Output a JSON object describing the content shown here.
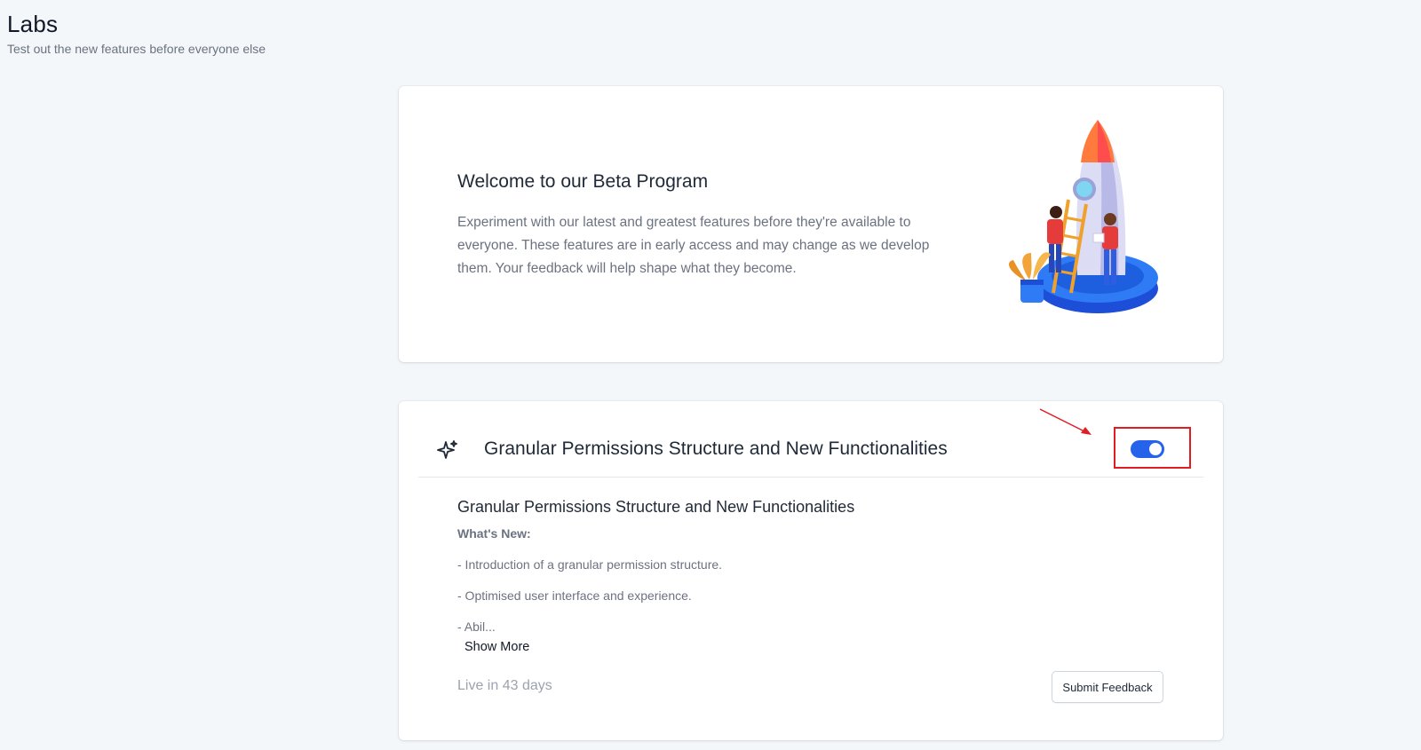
{
  "header": {
    "title": "Labs",
    "subtitle": "Test out the new features before everyone else"
  },
  "welcome": {
    "title": "Welcome to our Beta Program",
    "description": "Experiment with our latest and greatest features before they're available to everyone. These features are in early access and may change as we develop them. Your feedback will help shape what they become.",
    "illustration": "rocket-launch-illustration"
  },
  "feature": {
    "icon": "sparkle-icon",
    "title": "Granular Permissions Structure and New Functionalities",
    "enabled": true,
    "details_title": "Granular Permissions Structure and New Functionalities",
    "whats_new_label": "What's New:",
    "items": [
      "- Introduction of a granular permission structure.",
      "- Optimised user interface and experience.",
      "- Abil..."
    ],
    "show_more_label": "Show More",
    "live_status": "Live in 43 days",
    "feedback_label": "Submit Feedback"
  },
  "colors": {
    "background": "#f3f7fa",
    "accent": "#2563eb",
    "highlight": "#e11d24"
  }
}
